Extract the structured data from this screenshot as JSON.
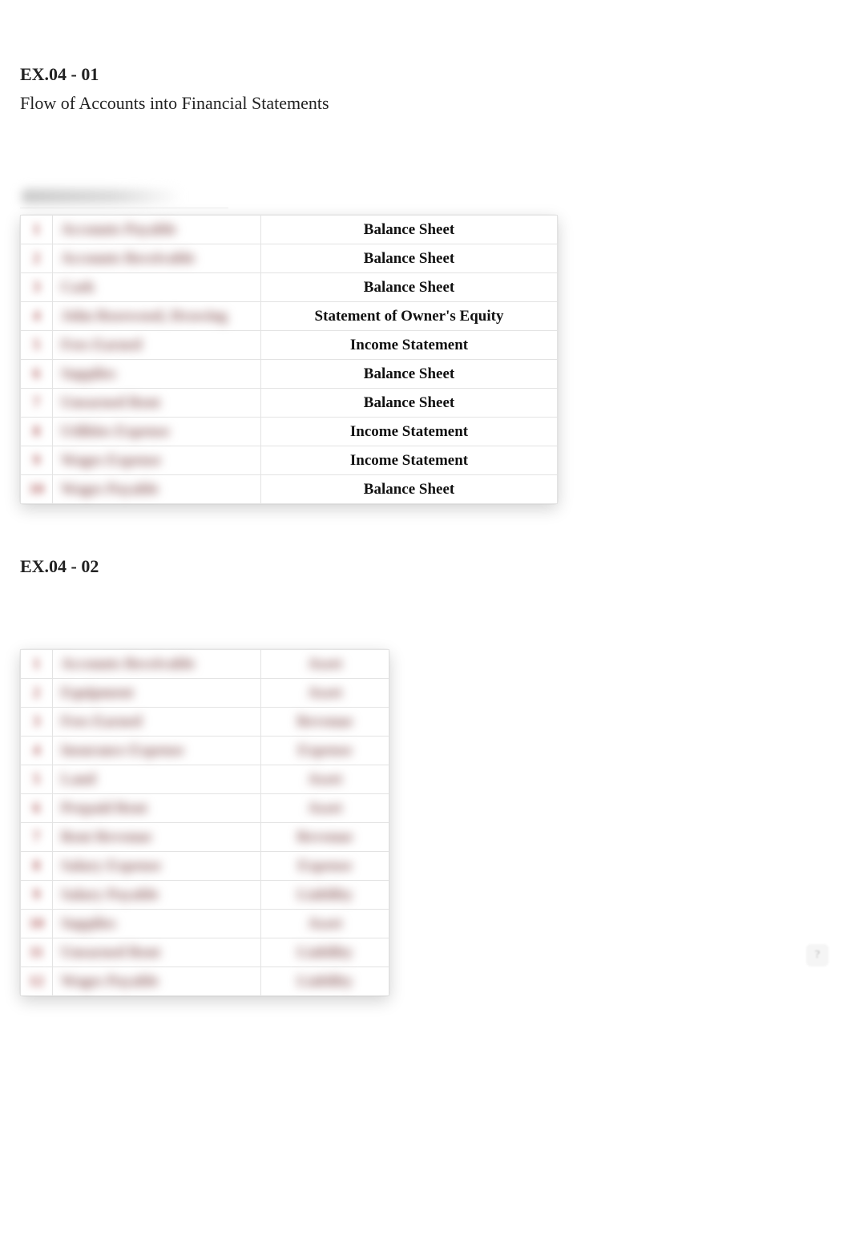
{
  "ex1": {
    "title": "EX.04 - 01",
    "subtitle": "Flow of Accounts into Financial Statements",
    "rows": [
      {
        "n": "1",
        "account": "Accounts Payable",
        "statement": "Balance Sheet"
      },
      {
        "n": "2",
        "account": "Accounts Receivable",
        "statement": "Balance Sheet"
      },
      {
        "n": "3",
        "account": "Cash",
        "statement": "Balance Sheet"
      },
      {
        "n": "4",
        "account": "John Rosewood, Drawing",
        "statement": "Statement of Owner's Equity"
      },
      {
        "n": "5",
        "account": "Fees Earned",
        "statement": "Income Statement"
      },
      {
        "n": "6",
        "account": "Supplies",
        "statement": "Balance Sheet"
      },
      {
        "n": "7",
        "account": "Unearned Rent",
        "statement": "Balance Sheet"
      },
      {
        "n": "8",
        "account": "Utilities Expense",
        "statement": "Income Statement"
      },
      {
        "n": "9",
        "account": "Wages Expense",
        "statement": "Income Statement"
      },
      {
        "n": "10",
        "account": "Wages Payable",
        "statement": "Balance Sheet"
      }
    ]
  },
  "ex2": {
    "title": "EX.04 - 02",
    "rows": [
      {
        "n": "1",
        "account": "Accounts Receivable",
        "class": "Asset"
      },
      {
        "n": "2",
        "account": "Equipment",
        "class": "Asset"
      },
      {
        "n": "3",
        "account": "Fees Earned",
        "class": "Revenue"
      },
      {
        "n": "4",
        "account": "Insurance Expense",
        "class": "Expense"
      },
      {
        "n": "5",
        "account": "Land",
        "class": "Asset"
      },
      {
        "n": "6",
        "account": "Prepaid Rent",
        "class": "Asset"
      },
      {
        "n": "7",
        "account": "Rent Revenue",
        "class": "Revenue"
      },
      {
        "n": "8",
        "account": "Salary Expense",
        "class": "Expense"
      },
      {
        "n": "9",
        "account": "Salary Payable",
        "class": "Liability"
      },
      {
        "n": "10",
        "account": "Supplies",
        "class": "Asset"
      },
      {
        "n": "11",
        "account": "Unearned Rent",
        "class": "Liability"
      },
      {
        "n": "12",
        "account": "Wages Payable",
        "class": "Liability"
      }
    ]
  }
}
